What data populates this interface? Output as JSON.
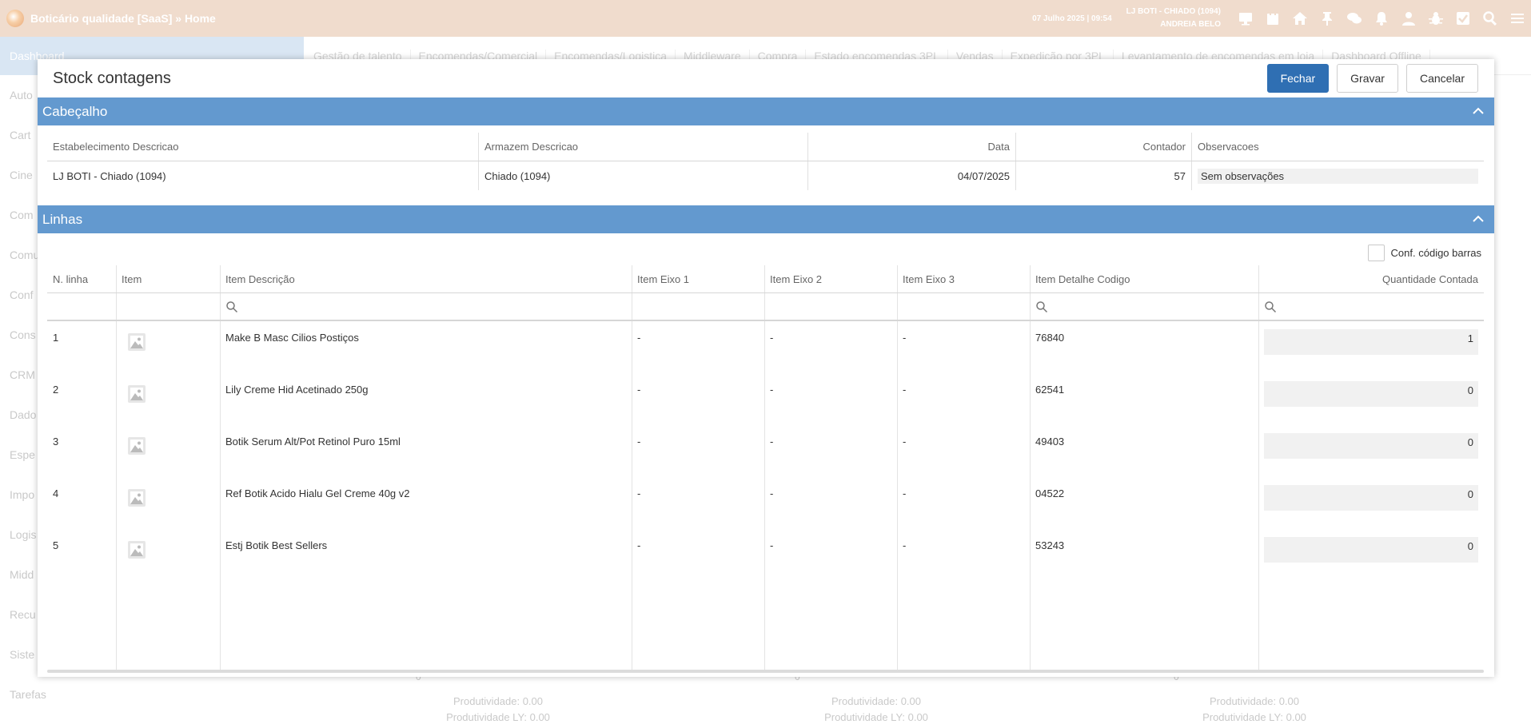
{
  "app": {
    "title": "Boticário qualidade [SaaS] » Home",
    "date": "07 Julho 2025 | 09:54",
    "store": "LJ BOTI - CHIADO (1094)",
    "user": "ANDREIA BELO"
  },
  "top_icons": [
    "monitor-icon",
    "calendar-icon",
    "home-icon",
    "pin-icon",
    "chat-icon",
    "bell-icon",
    "user-icon",
    "bug-icon",
    "checkbox-icon",
    "search-icon",
    "menu-icon"
  ],
  "sidebar": {
    "items": [
      "Dashboard",
      "Auto",
      "Cart",
      "Cine",
      "Com",
      "Comu",
      "Conf",
      "Cons",
      "CRM",
      "Dado",
      "Espe",
      "Impo",
      "Logis",
      "Midd",
      "Recu",
      "Siste",
      "Tarefas"
    ]
  },
  "nav_tabs": [
    "Gestão de talento",
    "Encomendas/Comercial",
    "Encomendas/Logistica",
    "Middleware",
    "Compra",
    "Estado encomendas 3PL",
    "Vendas",
    "Expedição por 3PL",
    "Levantamento de encomendas em loja",
    "Dashboard Offline"
  ],
  "bg_cards": [
    {
      "zero": "0",
      "p1": "Produtividade: 0.00",
      "p2": "Produtividade LY: 0.00"
    },
    {
      "zero": "0",
      "p1": "Produtividade: 0.00",
      "p2": "Produtividade LY: 0.00"
    },
    {
      "zero": "0",
      "p1": "Produtividade: 0.00",
      "p2": "Produtividade LY: 0.00"
    }
  ],
  "modal": {
    "title": "Stock contagens",
    "buttons": {
      "close": "Fechar",
      "save": "Gravar",
      "cancel": "Cancelar"
    },
    "header_section": "Cabeçalho",
    "lines_section": "Linhas",
    "header_table": {
      "columns": [
        "Estabelecimento Descricao",
        "Armazem Descricao",
        "Data",
        "Contador",
        "Observacoes"
      ],
      "row": {
        "estabelecimento": "LJ BOTI - Chiado (1094)",
        "armazem": "Chiado (1094)",
        "data": "04/07/2025",
        "contador": "57",
        "observacoes": "Sem observações"
      }
    },
    "barcode_label": "Conf. código barras",
    "lines_table": {
      "columns": [
        "N. linha",
        "Item",
        "Item Descrição",
        "Item Eixo 1",
        "Item Eixo 2",
        "Item Eixo 3",
        "Item Detalhe Codigo",
        "Quantidade Contada"
      ],
      "rows": [
        {
          "n": "1",
          "desc": "Make B Masc Cilios Postiços",
          "e1": "-",
          "e2": "-",
          "e3": "-",
          "code": "76840",
          "qty": "1"
        },
        {
          "n": "2",
          "desc": "Lily Creme Hid Acetinado 250g",
          "e1": "-",
          "e2": "-",
          "e3": "-",
          "code": "62541",
          "qty": "0"
        },
        {
          "n": "3",
          "desc": "Botik Serum Alt/Pot Retinol Puro 15ml",
          "e1": "-",
          "e2": "-",
          "e3": "-",
          "code": "49403",
          "qty": "0"
        },
        {
          "n": "4",
          "desc": "Ref Botik Acido Hialu Gel Creme 40g v2",
          "e1": "-",
          "e2": "-",
          "e3": "-",
          "code": "04522",
          "qty": "0"
        },
        {
          "n": "5",
          "desc": "Estj Botik Best Sellers",
          "e1": "-",
          "e2": "-",
          "e3": "-",
          "code": "53243",
          "qty": "0"
        }
      ]
    }
  }
}
